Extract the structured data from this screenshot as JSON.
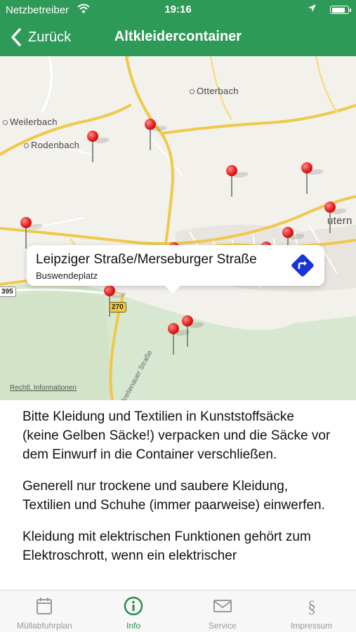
{
  "status_bar": {
    "carrier": "Netzbetreiber",
    "time": "19:16"
  },
  "nav": {
    "back_label": "Zurück",
    "title": "Altkleidercontainer"
  },
  "map": {
    "places": [
      "Otterbach",
      "Weilerbach",
      "Rodenbach"
    ],
    "partial_place": "utern",
    "road_shields": [
      "395",
      "270"
    ],
    "street_name": "Breitenauer Straße",
    "legal_link": "Rechtl. Informationen",
    "callout": {
      "title": "Leipziger Straße/Merseburger Straße",
      "subtitle": "Buswendeplatz"
    }
  },
  "content": {
    "paragraphs": [
      "Bitte Kleidung und Textilien in Kunststoffsäcke (keine Gelben Säcke!) verpacken und die Säcke vor dem Einwurf in die Container verschließen.",
      "Generell nur trockene und saubere Kleidung, Textilien und Schuhe (immer paarweise) einwerfen.",
      "Kleidung mit elektrischen Funktionen gehört zum Elektroschrott, wenn ein elektrischer"
    ]
  },
  "tabs": [
    {
      "label": "Müllabfuhrplan",
      "icon": "calendar-icon",
      "active": false
    },
    {
      "label": "Info",
      "icon": "info-icon",
      "active": true
    },
    {
      "label": "Service",
      "icon": "mail-icon",
      "active": false
    },
    {
      "label": "Impressum",
      "icon": "section-icon",
      "active": false
    }
  ],
  "colors": {
    "header": "#2d9a57",
    "active_tab": "#2d8a4a",
    "pin": "#e11a1a",
    "direction": "#1a34d6"
  }
}
